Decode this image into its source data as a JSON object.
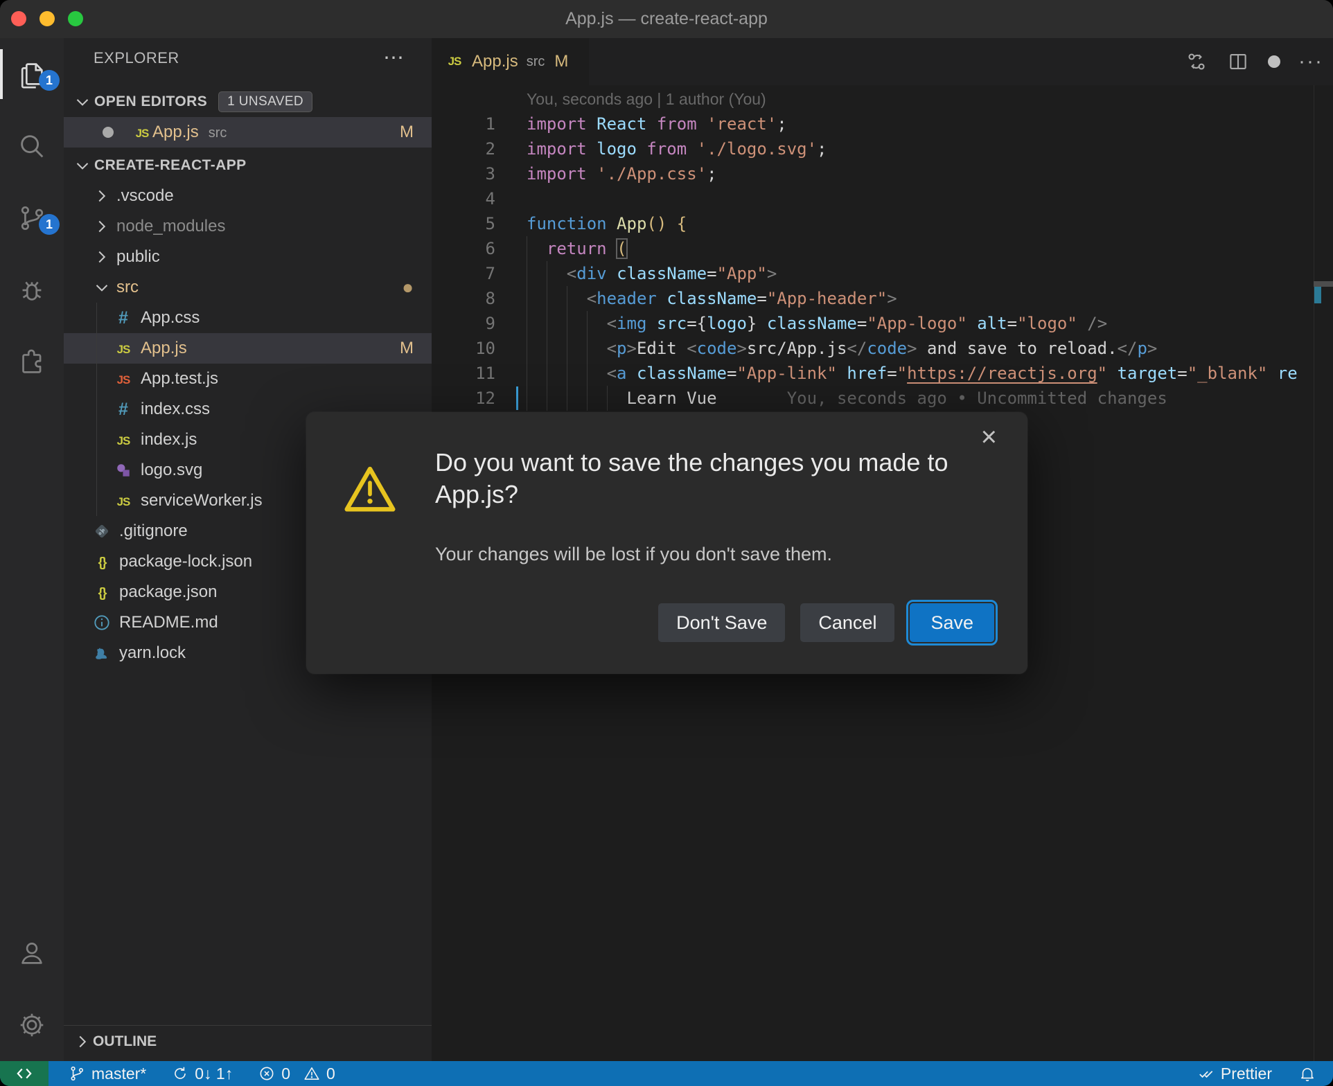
{
  "window": {
    "title": "App.js — create-react-app"
  },
  "activity_bar": {
    "items": [
      {
        "name": "files-icon",
        "badge": "1",
        "active": true
      },
      {
        "name": "search-icon"
      },
      {
        "name": "source-control-icon",
        "badge": "1"
      },
      {
        "name": "debug-icon"
      },
      {
        "name": "extensions-icon"
      }
    ],
    "bottom_items": [
      {
        "name": "account-icon"
      },
      {
        "name": "settings-gear-icon"
      }
    ]
  },
  "sidebar": {
    "title": "EXPLORER",
    "more_label": "⋯",
    "open_editors": {
      "label": "OPEN EDITORS",
      "badge": "1 UNSAVED",
      "items": [
        {
          "icon": "js",
          "label": "App.js",
          "desc": "src",
          "git": "M",
          "dirty": true,
          "selected": true
        }
      ]
    },
    "project_label": "CREATE-REACT-APP",
    "tree": [
      {
        "label": ".vscode",
        "chevron": "right",
        "indent": 0
      },
      {
        "label": "node_modules",
        "chevron": "right",
        "indent": 0,
        "dim": true
      },
      {
        "label": "public",
        "chevron": "right",
        "indent": 0
      },
      {
        "label": "src",
        "chevron": "down",
        "indent": 0,
        "modified": true,
        "dot": true
      },
      {
        "label": "App.css",
        "icon": "hash",
        "indent": 1
      },
      {
        "label": "App.js",
        "icon": "js",
        "indent": 1,
        "modified": true,
        "git": "M",
        "selected": true
      },
      {
        "label": "App.test.js",
        "icon": "js-test",
        "indent": 1
      },
      {
        "label": "index.css",
        "icon": "hash",
        "indent": 1
      },
      {
        "label": "index.js",
        "icon": "js",
        "indent": 1
      },
      {
        "label": "logo.svg",
        "icon": "svg",
        "indent": 1
      },
      {
        "label": "serviceWorker.js",
        "icon": "js",
        "indent": 1
      },
      {
        "label": ".gitignore",
        "icon": "git",
        "indent": 0
      },
      {
        "label": "package-lock.json",
        "icon": "json",
        "indent": 0
      },
      {
        "label": "package.json",
        "icon": "json",
        "indent": 0
      },
      {
        "label": "README.md",
        "icon": "info",
        "indent": 0
      },
      {
        "label": "yarn.lock",
        "icon": "yarn",
        "indent": 0
      }
    ],
    "outline_label": "OUTLINE"
  },
  "editor": {
    "tab": {
      "name": "App.js",
      "desc": "src",
      "git": "M"
    },
    "blame_header": "You, seconds ago | 1 author (You)",
    "lines": [
      {
        "n": "1",
        "t": [
          [
            "k",
            "import"
          ],
          [
            "p",
            " "
          ],
          [
            "v",
            "React"
          ],
          [
            "p",
            " "
          ],
          [
            "k",
            "from"
          ],
          [
            "p",
            " "
          ],
          [
            "s",
            "'react'"
          ],
          [
            "p",
            ";"
          ]
        ]
      },
      {
        "n": "2",
        "t": [
          [
            "k",
            "import"
          ],
          [
            "p",
            " "
          ],
          [
            "v",
            "logo"
          ],
          [
            "p",
            " "
          ],
          [
            "k",
            "from"
          ],
          [
            "p",
            " "
          ],
          [
            "s",
            "'./logo.svg'"
          ],
          [
            "p",
            ";"
          ]
        ]
      },
      {
        "n": "3",
        "t": [
          [
            "k",
            "import"
          ],
          [
            "p",
            " "
          ],
          [
            "s",
            "'./App.css'"
          ],
          [
            "p",
            ";"
          ]
        ]
      },
      {
        "n": "4",
        "t": []
      },
      {
        "n": "5",
        "t": [
          [
            "b",
            "function"
          ],
          [
            "p",
            " "
          ],
          [
            "f",
            "App"
          ],
          [
            "g",
            "()"
          ],
          [
            "p",
            " "
          ],
          [
            "g",
            "{"
          ]
        ]
      },
      {
        "n": "6",
        "t": [
          [
            "p",
            "  "
          ],
          [
            "k",
            "return"
          ],
          [
            "p",
            " "
          ],
          [
            "gm",
            "("
          ]
        ]
      },
      {
        "n": "7",
        "t": [
          [
            "p",
            "    "
          ],
          [
            "a",
            "<"
          ],
          [
            "b",
            "div"
          ],
          [
            "p",
            " "
          ],
          [
            "v",
            "className"
          ],
          [
            "p",
            "="
          ],
          [
            "s",
            "\"App\""
          ],
          [
            "a",
            ">"
          ]
        ]
      },
      {
        "n": "8",
        "t": [
          [
            "p",
            "      "
          ],
          [
            "a",
            "<"
          ],
          [
            "b",
            "header"
          ],
          [
            "p",
            " "
          ],
          [
            "v",
            "className"
          ],
          [
            "p",
            "="
          ],
          [
            "s",
            "\"App-header\""
          ],
          [
            "a",
            ">"
          ]
        ]
      },
      {
        "n": "9",
        "t": [
          [
            "p",
            "        "
          ],
          [
            "a",
            "<"
          ],
          [
            "b",
            "img"
          ],
          [
            "p",
            " "
          ],
          [
            "v",
            "src"
          ],
          [
            "p",
            "={"
          ],
          [
            "v",
            "logo"
          ],
          [
            "p",
            "} "
          ],
          [
            "v",
            "className"
          ],
          [
            "p",
            "="
          ],
          [
            "s",
            "\"App-logo\""
          ],
          [
            "p",
            " "
          ],
          [
            "v",
            "alt"
          ],
          [
            "p",
            "="
          ],
          [
            "s",
            "\"logo\""
          ],
          [
            "p",
            " "
          ],
          [
            "a",
            "/>"
          ]
        ]
      },
      {
        "n": "10",
        "t": [
          [
            "p",
            "        "
          ],
          [
            "a",
            "<"
          ],
          [
            "b",
            "p"
          ],
          [
            "a",
            ">"
          ],
          [
            "p",
            "Edit "
          ],
          [
            "a",
            "<"
          ],
          [
            "b",
            "code"
          ],
          [
            "a",
            ">"
          ],
          [
            "p",
            "src/App.js"
          ],
          [
            "a",
            "</"
          ],
          [
            "b",
            "code"
          ],
          [
            "a",
            ">"
          ],
          [
            "p",
            " and save to reload."
          ],
          [
            "a",
            "</"
          ],
          [
            "b",
            "p"
          ],
          [
            "a",
            ">"
          ]
        ]
      },
      {
        "n": "11",
        "t": [
          [
            "p",
            "        "
          ],
          [
            "a",
            "<"
          ],
          [
            "b",
            "a"
          ],
          [
            "p",
            " "
          ],
          [
            "v",
            "className"
          ],
          [
            "p",
            "="
          ],
          [
            "s",
            "\"App-link\""
          ],
          [
            "p",
            " "
          ],
          [
            "v",
            "href"
          ],
          [
            "p",
            "="
          ],
          [
            "s",
            "\""
          ],
          [
            "u",
            "https://reactjs.org"
          ],
          [
            "s",
            "\""
          ],
          [
            "p",
            " "
          ],
          [
            "v",
            "target"
          ],
          [
            "p",
            "="
          ],
          [
            "s",
            "\"_blank\""
          ],
          [
            "p",
            " "
          ],
          [
            "v",
            "re"
          ]
        ]
      },
      {
        "n": "12",
        "cursor": true,
        "t": [
          [
            "p",
            "          "
          ],
          [
            "p",
            "Learn Vue"
          ],
          [
            "bl",
            "       You, seconds ago • Uncommitted changes"
          ]
        ]
      }
    ]
  },
  "dialog": {
    "title": "Do you want to save the changes you made to App.js?",
    "message": "Your changes will be lost if you don't save them.",
    "dont_save": "Don't Save",
    "cancel": "Cancel",
    "save": "Save",
    "close": "×"
  },
  "status_bar": {
    "branch": "master*",
    "sync": "0↓ 1↑",
    "errors": "0",
    "warnings": "0",
    "formatter": "Prettier"
  },
  "colors": {
    "accent_blue": "#0e6fb4",
    "remote_green": "#17744f",
    "badge_blue": "#2574cf",
    "git_modified": "#e2c08d",
    "selection": "#37373d",
    "save_button": "#0f73c4",
    "warning_yellow": "#e7c41f"
  }
}
